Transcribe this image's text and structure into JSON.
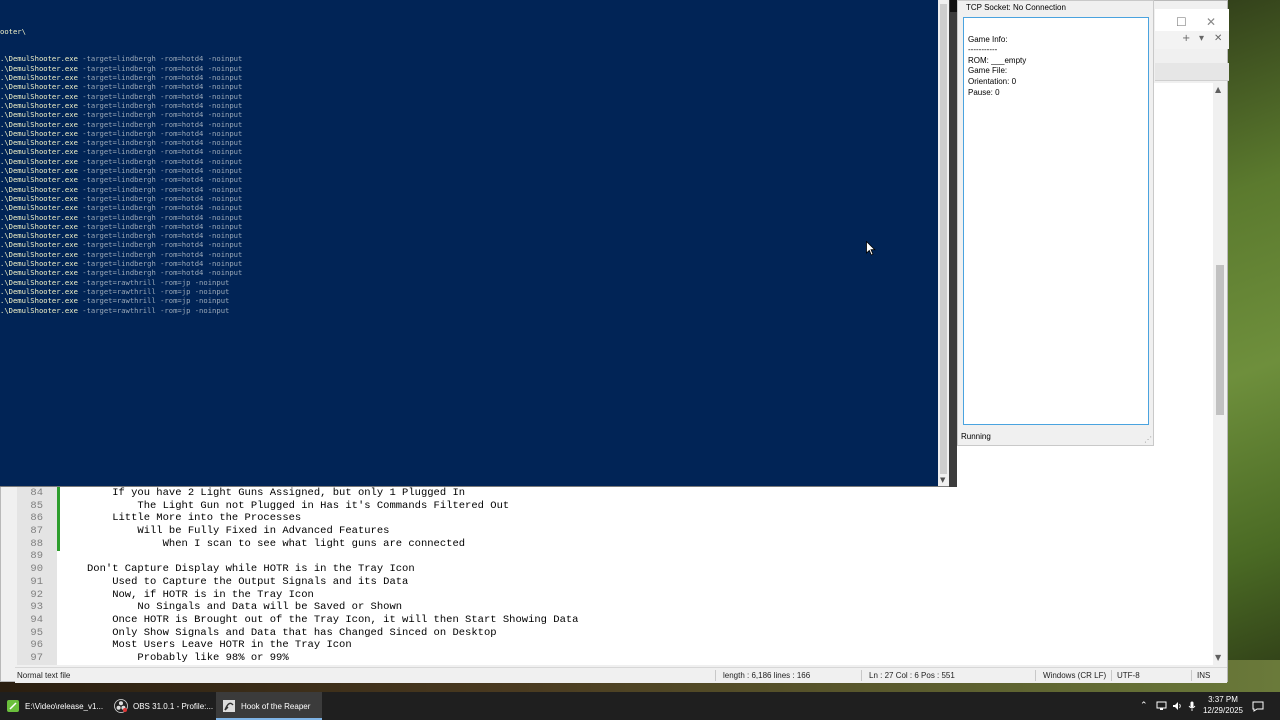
{
  "notepadpp": {
    "lines": [
      {
        "num": "84",
        "text": "    If you have 2 Light Guns Assigned, but only 1 Plugged In"
      },
      {
        "num": "85",
        "text": "        The Light Gun not Plugged in Has it's Commands Filtered Out"
      },
      {
        "num": "86",
        "text": "    Little More into the Processes"
      },
      {
        "num": "87",
        "text": "        Will be Fully Fixed in Advanced Features"
      },
      {
        "num": "88",
        "text": "            When I scan to see what light guns are connected"
      },
      {
        "num": "89",
        "text": ""
      },
      {
        "num": "90",
        "text": "Don't Capture Display while HOTR is in the Tray Icon"
      },
      {
        "num": "91",
        "text": "    Used to Capture the Output Signals and its Data"
      },
      {
        "num": "92",
        "text": "    Now, if HOTR is in the Tray Icon"
      },
      {
        "num": "93",
        "text": "        No Singals and Data will be Saved or Shown"
      },
      {
        "num": "94",
        "text": "    Once HOTR is Brought out of the Tray Icon, it will then Start Showing Data"
      },
      {
        "num": "95",
        "text": "    Only Show Signals and Data that has Changed Sinced on Desktop"
      },
      {
        "num": "96",
        "text": "    Most Users Leave HOTR in the Tray Icon"
      },
      {
        "num": "97",
        "text": "        Probably like 98% or 99%"
      }
    ],
    "status": {
      "file_type": "Normal text file",
      "length_lines": "length : 6,186    lines : 166",
      "position": "Ln : 27    Col : 6    Pos : 551",
      "eol": "Windows (CR LF)",
      "encoding": "UTF-8",
      "mode": "INS"
    },
    "tab_controls": {
      "add": "+",
      "menu": "▾",
      "close": "✕"
    },
    "window_controls": {
      "maximize": "☐",
      "close": "✕"
    }
  },
  "powershell": {
    "path_fragment": "ooter\\",
    "commands": [
      {
        "exe": ".\\DemulShooter.exe",
        "args": " -target=lindbergh -rom=hotd4 -noinput"
      },
      {
        "exe": ".\\DemulShooter.exe",
        "args": " -target=lindbergh -rom=hotd4 -noinput"
      },
      {
        "exe": ".\\DemulShooter.exe",
        "args": " -target=lindbergh -rom=hotd4 -noinput"
      },
      {
        "exe": ".\\DemulShooter.exe",
        "args": " -target=lindbergh -rom=hotd4 -noinput"
      },
      {
        "exe": ".\\DemulShooter.exe",
        "args": " -target=lindbergh -rom=hotd4 -noinput"
      },
      {
        "exe": ".\\DemulShooter.exe",
        "args": " -target=lindbergh -rom=hotd4 -noinput"
      },
      {
        "exe": ".\\DemulShooter.exe",
        "args": " -target=lindbergh -rom=hotd4 -noinput"
      },
      {
        "exe": ".\\DemulShooter.exe",
        "args": " -target=lindbergh -rom=hotd4 -noinput"
      },
      {
        "exe": ".\\DemulShooter.exe",
        "args": " -target=lindbergh -rom=hotd4 -noinput"
      },
      {
        "exe": ".\\DemulShooter.exe",
        "args": " -target=lindbergh -rom=hotd4 -noinput"
      },
      {
        "exe": ".\\DemulShooter.exe",
        "args": " -target=lindbergh -rom=hotd4 -noinput"
      },
      {
        "exe": ".\\DemulShooter.exe",
        "args": " -target=lindbergh -rom=hotd4 -noinput"
      },
      {
        "exe": ".\\DemulShooter.exe",
        "args": " -target=lindbergh -rom=hotd4 -noinput"
      },
      {
        "exe": ".\\DemulShooter.exe",
        "args": " -target=lindbergh -rom=hotd4 -noinput"
      },
      {
        "exe": ".\\DemulShooter.exe",
        "args": " -target=lindbergh -rom=hotd4 -noinput"
      },
      {
        "exe": ".\\DemulShooter.exe",
        "args": " -target=lindbergh -rom=hotd4 -noinput"
      },
      {
        "exe": ".\\DemulShooter.exe",
        "args": " -target=lindbergh -rom=hotd4 -noinput"
      },
      {
        "exe": ".\\DemulShooter.exe",
        "args": " -target=lindbergh -rom=hotd4 -noinput"
      },
      {
        "exe": ".\\DemulShooter.exe",
        "args": " -target=lindbergh -rom=hotd4 -noinput"
      },
      {
        "exe": ".\\DemulShooter.exe",
        "args": " -target=lindbergh -rom=hotd4 -noinput"
      },
      {
        "exe": ".\\DemulShooter.exe",
        "args": " -target=lindbergh -rom=hotd4 -noinput"
      },
      {
        "exe": ".\\DemulShooter.exe",
        "args": " -target=lindbergh -rom=hotd4 -noinput"
      },
      {
        "exe": ".\\DemulShooter.exe",
        "args": " -target=lindbergh -rom=hotd4 -noinput"
      },
      {
        "exe": ".\\DemulShooter.exe",
        "args": " -target=lindbergh -rom=hotd4 -noinput"
      },
      {
        "exe": ".\\DemulShooter.exe",
        "args": " -target=rawthrill -rom=jp -noinput"
      },
      {
        "exe": ".\\DemulShooter.exe",
        "args": " -target=rawthrill -rom=jp -noinput"
      },
      {
        "exe": ".\\DemulShooter.exe",
        "args": " -target=rawthrill -rom=jp -noinput"
      },
      {
        "exe": ".\\DemulShooter.exe",
        "args": " -target=rawthrill -rom=jp -noinput"
      }
    ]
  },
  "hotr": {
    "tcp_status": "TCP Socket: No Connection",
    "info_lines": [
      "Game Info:",
      "-----------",
      "ROM: ___empty",
      "Game File:",
      "Orientation: 0",
      "Pause: 0"
    ],
    "status": "Running"
  },
  "taskbar": {
    "items": [
      {
        "label": "E:\\Video\\release_v1...",
        "icon": "notepadpp-icon",
        "active": false
      },
      {
        "label": "OBS 31.0.1 - Profile:...",
        "icon": "obs-icon",
        "active": false
      },
      {
        "label": "Hook of the Reaper",
        "icon": "hotr-icon",
        "active": true
      }
    ],
    "tray_icons": [
      "chevron-up-icon",
      "network-icon",
      "volume-icon",
      "microphone-icon"
    ],
    "time": "3:37 PM",
    "date": "12/29/2025"
  },
  "colors": {
    "powershell_bg": "#012456",
    "taskbar_bg": "#1f1f1f",
    "accent": "#4aa3df",
    "changebar": "#2e9e2e"
  }
}
